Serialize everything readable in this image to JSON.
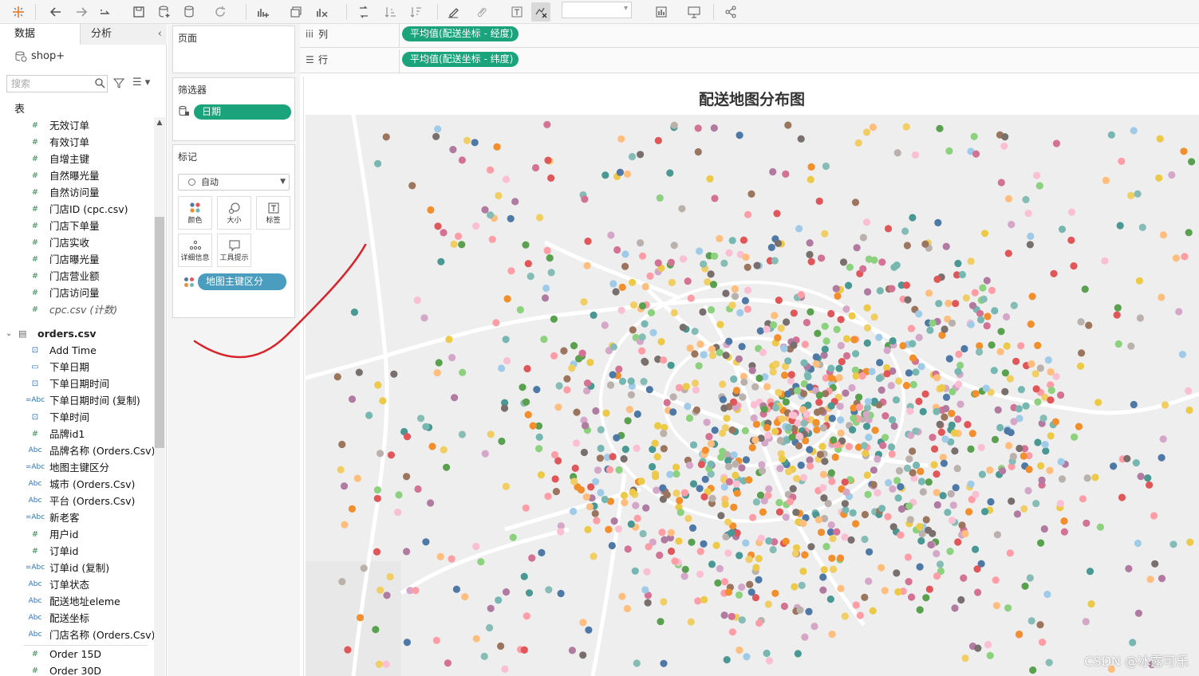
{
  "toolbar": {
    "icons": [
      "tableau-logo-icon",
      "undo-icon",
      "redo-icon",
      "replay-icon",
      "save-icon",
      "new-datasource-icon",
      "pause-icon",
      "refresh-icon",
      "new-worksheet-icon",
      "duplicate-icon",
      "clear-icon",
      "swap-icon",
      "sort-asc-icon",
      "sort-desc-icon",
      "highlight-icon",
      "group-icon",
      "label-icon",
      "fix-axes-icon",
      "fit-dropdown",
      "show-me-icon",
      "presentation-icon",
      "share-icon"
    ]
  },
  "datapane": {
    "tab_data": "数据",
    "tab_analysis": "分析",
    "datasource": "shop+",
    "search_placeholder": "搜索",
    "section_tables": "表",
    "fields_cpc": [
      {
        "type": "#",
        "label": "无效订单"
      },
      {
        "type": "#",
        "label": "有效订单"
      },
      {
        "type": "#",
        "label": "自增主键"
      },
      {
        "type": "#",
        "label": "自然曝光量"
      },
      {
        "type": "#",
        "label": "自然访问量"
      },
      {
        "type": "#",
        "label": "门店ID (cpc.csv)"
      },
      {
        "type": "#",
        "label": "门店下单量"
      },
      {
        "type": "#",
        "label": "门店实收"
      },
      {
        "type": "#",
        "label": "门店曝光量"
      },
      {
        "type": "#",
        "label": "门店营业额"
      },
      {
        "type": "#",
        "label": "门店访问量"
      },
      {
        "type": "#",
        "label": "cpc.csv (计数)"
      }
    ],
    "orders_table": "orders.csv",
    "fields_orders": [
      {
        "type": "cal2",
        "label": "Add Time"
      },
      {
        "type": "cal",
        "label": "下单日期"
      },
      {
        "type": "cal2",
        "label": "下单日期时间"
      },
      {
        "type": "=Abc",
        "label": "下单日期时间 (复制)"
      },
      {
        "type": "cal2",
        "label": "下单时间"
      },
      {
        "type": "#",
        "label": "品牌id1"
      },
      {
        "type": "Abc",
        "label": "品牌名称 (Orders.Csv)"
      },
      {
        "type": "=Abc",
        "label": "地图主键区分"
      },
      {
        "type": "Abc",
        "label": "城市 (Orders.Csv)"
      },
      {
        "type": "Abc",
        "label": "平台 (Orders.Csv)"
      },
      {
        "type": "=Abc",
        "label": "新老客"
      },
      {
        "type": "#",
        "label": "用户id"
      },
      {
        "type": "#",
        "label": "订单id"
      },
      {
        "type": "=Abc",
        "label": "订单id (复制)"
      },
      {
        "type": "Abc",
        "label": "订单状态"
      },
      {
        "type": "Abc",
        "label": "配送地址eleme"
      },
      {
        "type": "Abc",
        "label": "配送坐标"
      },
      {
        "type": "Abc",
        "label": "门店名称 (Orders.Csv)"
      }
    ],
    "fields_measures": [
      {
        "type": "#",
        "label": "Order 15D"
      },
      {
        "type": "#",
        "label": "Order 30D"
      }
    ]
  },
  "cards": {
    "pages_title": "页面",
    "filters_title": "筛选器",
    "filter_pill": "日期",
    "marks_title": "标记",
    "mark_type": "自动",
    "btn_color": "颜色",
    "btn_size": "大小",
    "btn_label": "标签",
    "btn_detail": "详细信息",
    "btn_tooltip": "工具提示",
    "color_pill": "地图主键区分"
  },
  "shelves": {
    "columns_label": "列",
    "columns_pill": "平均值(配送坐标 - 经度)",
    "rows_label": "行",
    "rows_pill": "平均值(配送坐标 - 纬度)"
  },
  "view": {
    "title": "配送地图分布图",
    "watermark": "CSDN @冰露可乐"
  },
  "chart_data": {
    "type": "scatter",
    "title": "配送地图分布图",
    "x_field": "平均值(配送坐标 - 经度)",
    "y_field": "平均值(配送坐标 - 纬度)",
    "color_field": "地图主键区分",
    "background": "map",
    "approx_point_count": 1400,
    "palette": [
      "#4e79a7",
      "#f28e2b",
      "#e15759",
      "#76b7b2",
      "#59a14f",
      "#edc948",
      "#b07aa1",
      "#ff9da7",
      "#9c755f",
      "#bab0ac",
      "#d37295",
      "#fabfd2",
      "#86bcb6",
      "#8cd17d",
      "#f1ce63",
      "#a0cbe8",
      "#ffbe7d",
      "#499894",
      "#79706e",
      "#d4a6c8"
    ],
    "dense_center": [
      0.55,
      0.55
    ]
  }
}
